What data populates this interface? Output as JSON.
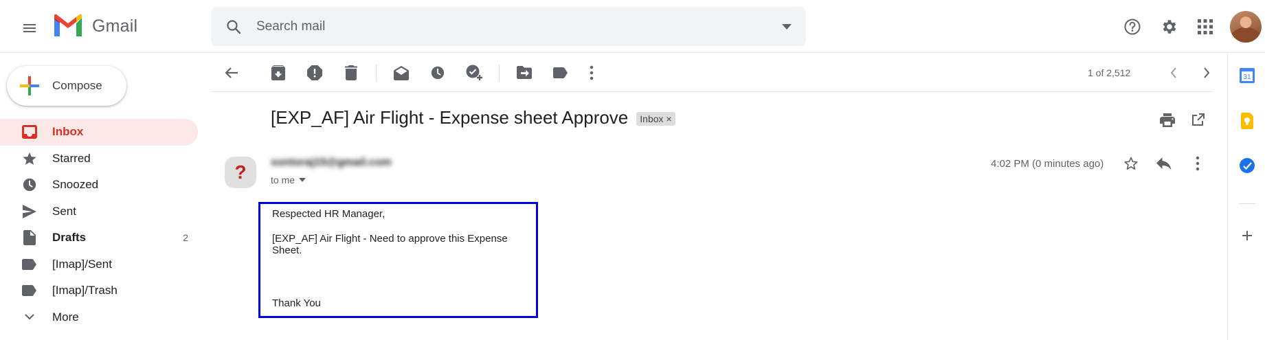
{
  "header": {
    "app_name": "Gmail",
    "search_placeholder": "Search mail",
    "icons": [
      "menu-icon",
      "gmail-logo",
      "search-icon",
      "dropdown-icon",
      "help-icon",
      "settings-icon",
      "apps-icon",
      "avatar"
    ]
  },
  "sidebar": {
    "compose_label": "Compose",
    "items": [
      {
        "label": "Inbox",
        "icon": "inbox-icon",
        "active": true
      },
      {
        "label": "Starred",
        "icon": "star-icon"
      },
      {
        "label": "Snoozed",
        "icon": "clock-icon"
      },
      {
        "label": "Sent",
        "icon": "send-icon"
      },
      {
        "label": "Drafts",
        "icon": "draft-icon",
        "count": "2",
        "bold": true
      },
      {
        "label": "[Imap]/Sent",
        "icon": "label-icon"
      },
      {
        "label": "[Imap]/Trash",
        "icon": "label-icon"
      },
      {
        "label": "More",
        "icon": "chevron-down-icon"
      }
    ]
  },
  "toolbar": {
    "pager": "1 of 2,512",
    "icons": [
      "back-icon",
      "archive-icon",
      "report-spam-icon",
      "delete-icon",
      "mark-unread-icon",
      "snooze-icon",
      "add-task-icon",
      "move-to-icon",
      "labels-icon",
      "more-icon",
      "prev-icon",
      "next-icon"
    ]
  },
  "message": {
    "subject": "[EXP_AF] Air Flight - Expense sheet Approve",
    "label_chip": "Inbox",
    "label_chip_close": "×",
    "sender_avatar_glyph": "?",
    "sender": "sontoraj15@gmail.com",
    "to_line": "to me",
    "time": "4:02 PM (0 minutes ago)",
    "body": {
      "greeting": "Respected HR Manager,",
      "line1": "[EXP_AF] Air Flight - Need to approve this Expense Sheet.",
      "closing": "Thank You"
    }
  },
  "side_panel": {
    "calendar_day": "31",
    "icons": [
      "calendar-icon",
      "keep-icon",
      "tasks-icon",
      "add-icon"
    ]
  },
  "colors": {
    "accent_red": "#d93025",
    "active_bg": "#fce8e6",
    "highlight_box": "#0000e0",
    "search_bg": "#f1f3f4"
  }
}
